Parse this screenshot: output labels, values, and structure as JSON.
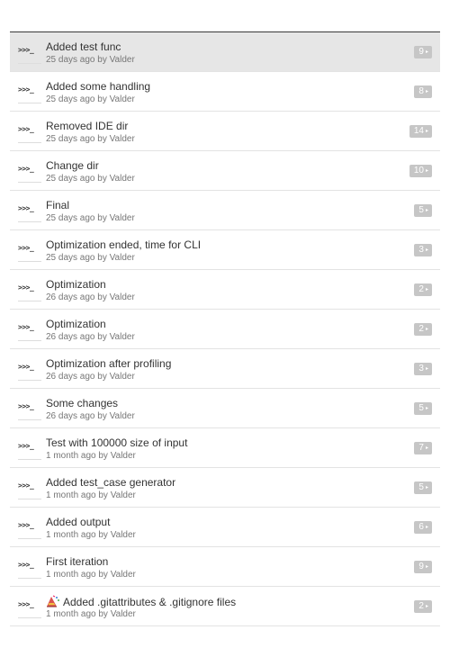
{
  "colors": {
    "selected_row_bg": "#e6e6e6",
    "badge_bg": "#c6c6c6",
    "meta_text": "#777777",
    "divider": "#e3e3e3"
  },
  "commits": [
    {
      "avatar": ">>>_",
      "message": "Added test func",
      "meta": "25 days ago by Valder",
      "count": "9",
      "arrow": "▸",
      "selected": true
    },
    {
      "avatar": ">>>_",
      "message": "Added some handling",
      "meta": "25 days ago by Valder",
      "count": "8",
      "arrow": "▸"
    },
    {
      "avatar": ">>>_",
      "message": "Removed IDE dir",
      "meta": "25 days ago by Valder",
      "count": "14",
      "arrow": "▸"
    },
    {
      "avatar": ">>>_",
      "message": "Change dir",
      "meta": "25 days ago by Valder",
      "count": "10",
      "arrow": "▸"
    },
    {
      "avatar": ">>>_",
      "message": "Final",
      "meta": "25 days ago by Valder",
      "count": "5",
      "arrow": "▸"
    },
    {
      "avatar": ">>>_",
      "message": "Optimization ended, time for CLI",
      "meta": "25 days ago by Valder",
      "count": "3",
      "arrow": "▸"
    },
    {
      "avatar": ">>>_",
      "message": "Optimization",
      "meta": "26 days ago by Valder",
      "count": "2",
      "arrow": "▸"
    },
    {
      "avatar": ">>>_",
      "message": "Optimization",
      "meta": "26 days ago by Valder",
      "count": "2",
      "arrow": "▸"
    },
    {
      "avatar": ">>>_",
      "message": "Optimization after profiling",
      "meta": "26 days ago by Valder",
      "count": "3",
      "arrow": "▸"
    },
    {
      "avatar": ">>>_",
      "message": "Some changes",
      "meta": "26 days ago by Valder",
      "count": "5",
      "arrow": "▸"
    },
    {
      "avatar": ">>>_",
      "message": "Test with 100000 size of input",
      "meta": "1 month ago by Valder",
      "count": "7",
      "arrow": "▸"
    },
    {
      "avatar": ">>>_",
      "message": "Added test_case generator",
      "meta": "1 month ago by Valder",
      "count": "5",
      "arrow": "▸"
    },
    {
      "avatar": ">>>_",
      "message": "Added output",
      "meta": "1 month ago by Valder",
      "count": "6",
      "arrow": "▸"
    },
    {
      "avatar": ">>>_",
      "message": "First iteration",
      "meta": "1 month ago by Valder",
      "count": "9",
      "arrow": "▸"
    },
    {
      "avatar": ">>>_",
      "message": "Added .gitattributes & .gitignore files",
      "meta": "1 month ago by Valder",
      "count": "2",
      "arrow": "▸",
      "icon": "tada-emoji-icon"
    }
  ]
}
